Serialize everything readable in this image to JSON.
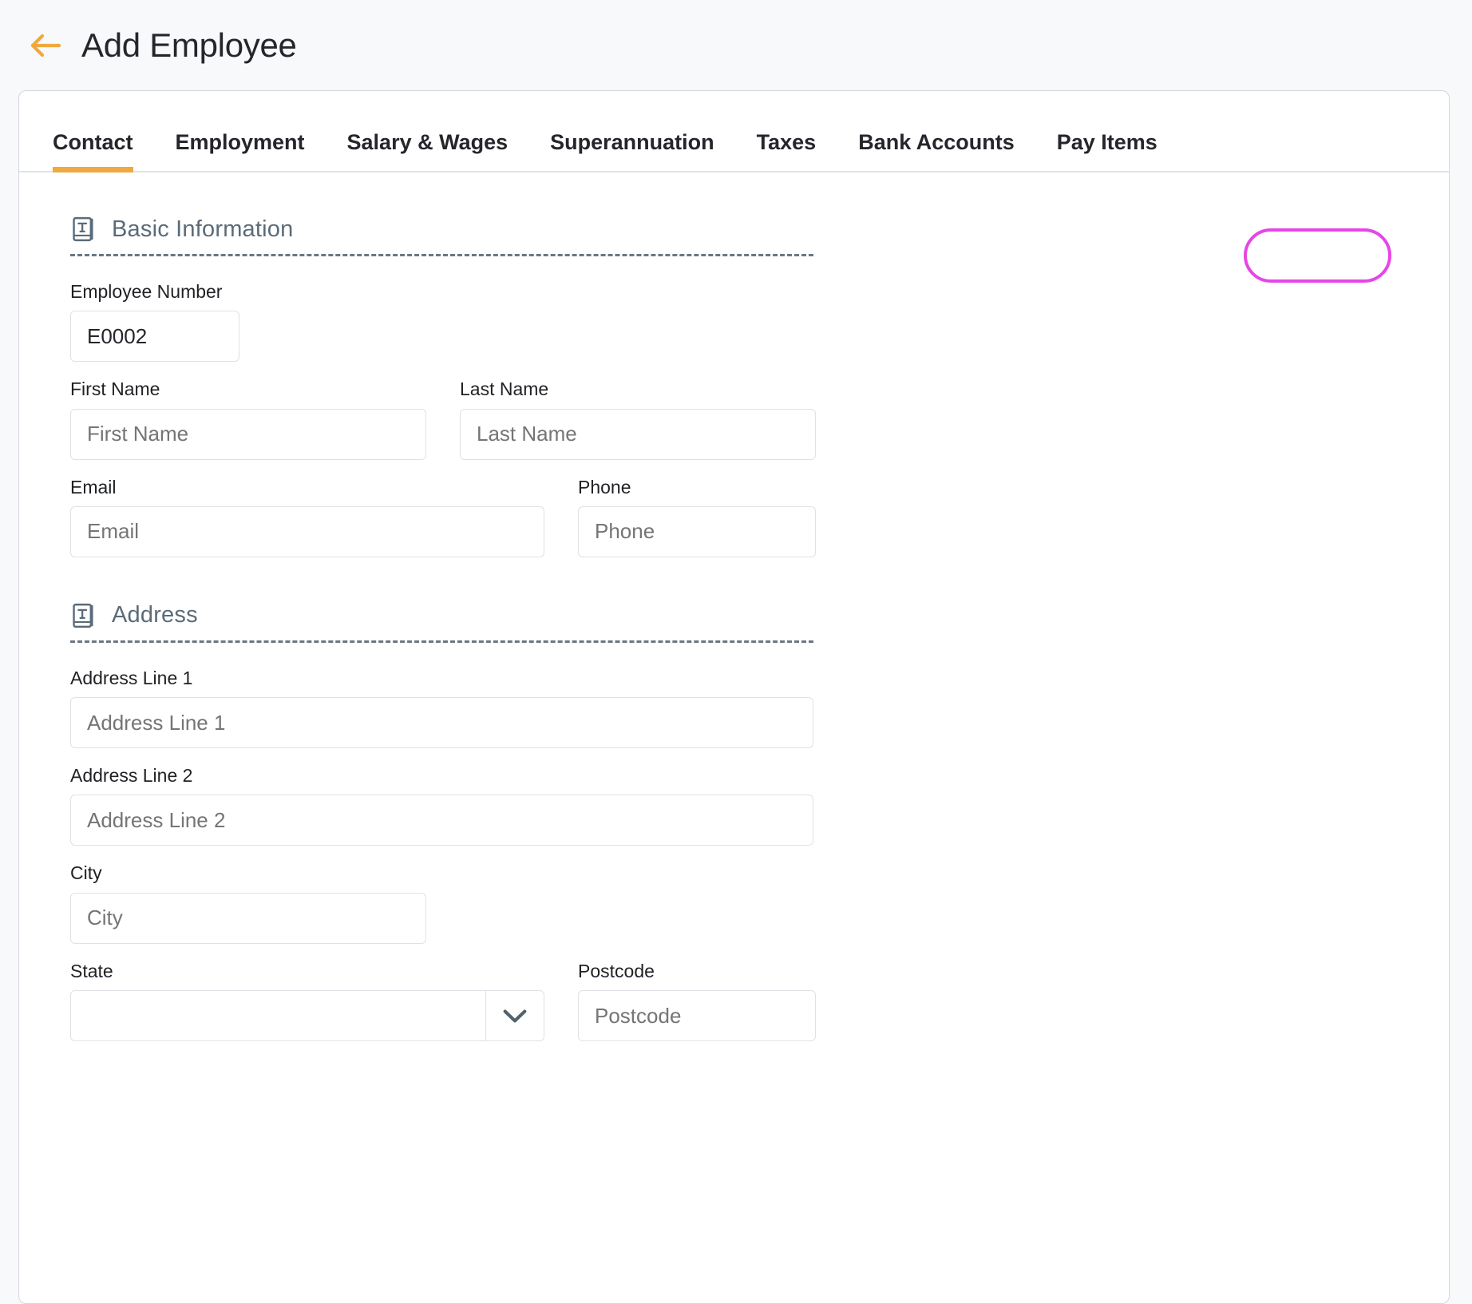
{
  "header": {
    "title": "Add Employee",
    "back_icon": "arrow-left-icon",
    "accent_color": "#efa93e"
  },
  "tabs": {
    "items": [
      {
        "label": "Contact",
        "active": true
      },
      {
        "label": "Employment",
        "active": false
      },
      {
        "label": "Salary & Wages",
        "active": false
      },
      {
        "label": "Superannuation",
        "active": false
      },
      {
        "label": "Taxes",
        "active": false
      },
      {
        "label": "Bank Accounts",
        "active": false
      },
      {
        "label": "Pay Items",
        "active": false,
        "highlighted": true
      }
    ],
    "highlight_color": "#e646e6"
  },
  "sections": [
    {
      "title": "Basic Information",
      "icon": "text-book-icon"
    },
    {
      "title": "Address",
      "icon": "text-book-icon"
    }
  ],
  "fields": {
    "employee_number": {
      "label": "Employee Number",
      "value": "E0002",
      "placeholder": ""
    },
    "first_name": {
      "label": "First Name",
      "value": "",
      "placeholder": "First Name"
    },
    "last_name": {
      "label": "Last Name",
      "value": "",
      "placeholder": "Last Name"
    },
    "email": {
      "label": "Email",
      "value": "",
      "placeholder": "Email"
    },
    "phone": {
      "label": "Phone",
      "value": "",
      "placeholder": "Phone"
    },
    "address_line_1": {
      "label": "Address Line 1",
      "value": "",
      "placeholder": "Address Line 1"
    },
    "address_line_2": {
      "label": "Address Line 2",
      "value": "",
      "placeholder": "Address Line 2"
    },
    "city": {
      "label": "City",
      "value": "",
      "placeholder": "City"
    },
    "state": {
      "label": "State",
      "value": "",
      "placeholder": "",
      "icon": "chevron-down-icon"
    },
    "postcode": {
      "label": "Postcode",
      "value": "",
      "placeholder": "Postcode"
    }
  }
}
